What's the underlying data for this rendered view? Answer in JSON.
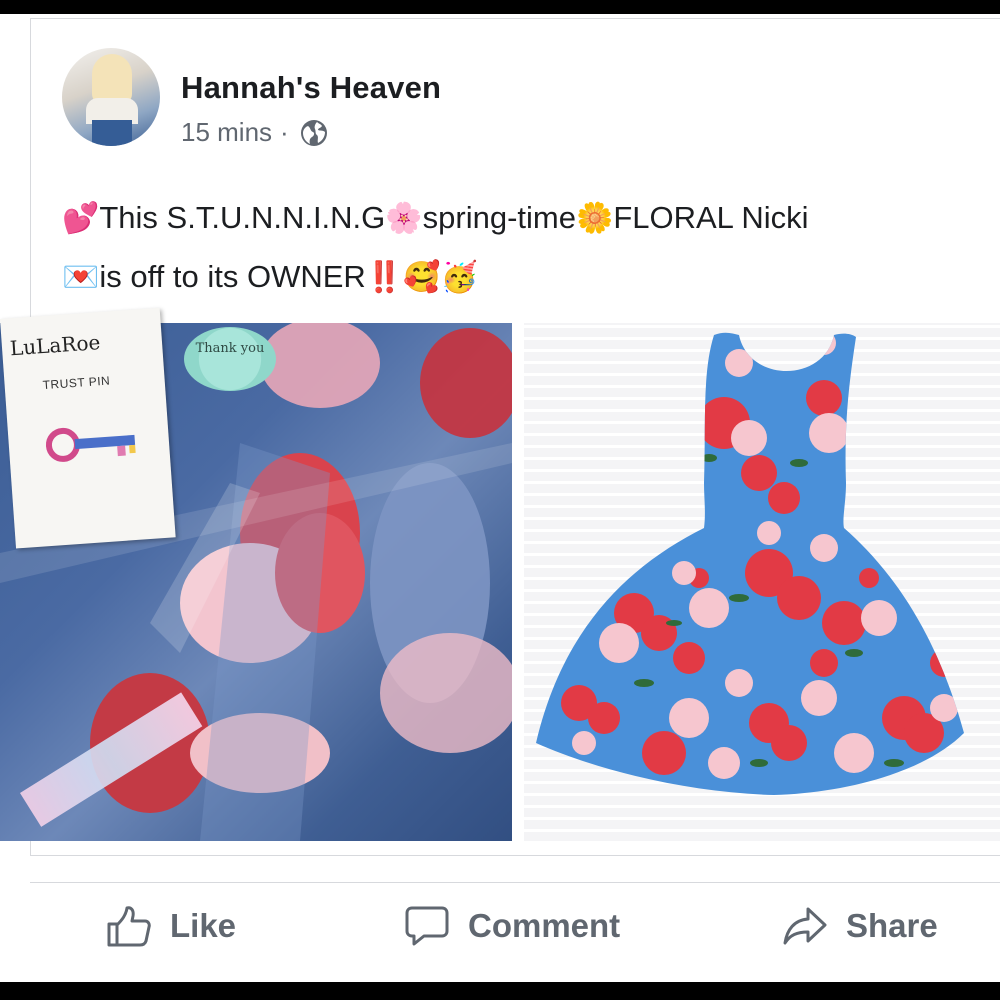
{
  "post": {
    "author": "Hannah's Heaven",
    "time": "15 mins",
    "separator": "·",
    "icons": {
      "privacy": "globe-icon"
    },
    "text_line1": {
      "e1": "💕",
      "t1": "This S.T.U.N.N.I.N.G",
      "e2": "🌸",
      "t2": "spring-time",
      "e3": "🌼",
      "t3": "FLORAL Nicki"
    },
    "text_line2": {
      "e1": "💌",
      "t1": "is off to its OWNER",
      "e2": "‼️",
      "e3": "🥰",
      "e4": "🥳"
    }
  },
  "photos": {
    "left": {
      "brand_logo": "LuLaRoe",
      "trust_pin": "TRUST PIN",
      "thank_you": "Thank you"
    },
    "right": {
      "dress_colors": {
        "base": "#4a90d9",
        "rose": "#e23a45",
        "pink": "#f6c6cf",
        "leaf": "#2f6b3a"
      }
    }
  },
  "actions": {
    "like": "Like",
    "comment": "Comment",
    "share": "Share"
  },
  "colors": {
    "text": "#1c1e21",
    "secondary": "#606770",
    "border": "#d7d9dd"
  }
}
